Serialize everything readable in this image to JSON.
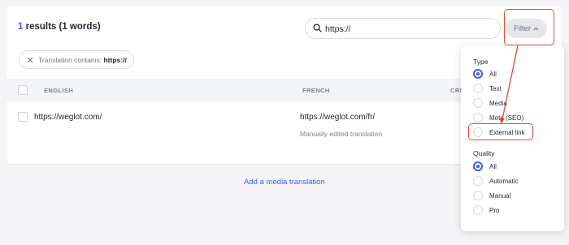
{
  "header": {
    "results_count": "1",
    "results_text": " results (1 words)"
  },
  "search": {
    "value": "https://",
    "icon": "search-icon"
  },
  "filter_button": {
    "label": "Filter",
    "icon": "chevron-up-icon"
  },
  "active_filter": {
    "prefix": "Translation contains: ",
    "value": "https://",
    "icon": "close-icon"
  },
  "table": {
    "columns": [
      "ENGLISH",
      "FRENCH",
      "CRE"
    ],
    "rows": [
      {
        "english": "https://weglot.com/",
        "french": "https://weglot.com/fr/",
        "note": "Manually edited translation"
      }
    ]
  },
  "add_media_link": "Add a media translation",
  "dropdown": {
    "type_title": "Type",
    "type_options": [
      "All",
      "Text",
      "Media",
      "Meta (SEO)",
      "External link"
    ],
    "type_selected": "All",
    "quality_title": "Quality",
    "quality_options": [
      "All",
      "Automatic",
      "Manual",
      "Pro"
    ],
    "quality_selected": "All"
  },
  "colors": {
    "accent": "#3b5bfd",
    "highlight": "#e34b2f"
  }
}
